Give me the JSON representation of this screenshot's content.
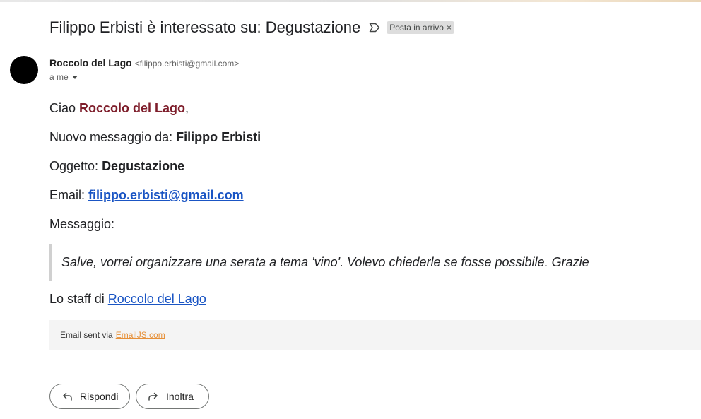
{
  "email": {
    "subject": "Filippo Erbisti è interessato su: Degustazione",
    "label_chip": "Posta in arrivo",
    "label_chip_close": "×",
    "sender_name": "Roccolo del Lago",
    "sender_email": "<filippo.erbisti@gmail.com>",
    "recipient": "a me"
  },
  "body": {
    "greeting_prefix": "Ciao ",
    "greeting_name": "Roccolo del Lago",
    "greeting_suffix": ",",
    "from_label": "Nuovo messaggio da: ",
    "from_name": "Filippo Erbisti",
    "subject_label": "Oggetto: ",
    "subject_value": "Degustazione",
    "email_label": "Email: ",
    "email_value": "filippo.erbisti@gmail.com",
    "message_label": "Messaggio:",
    "message_text": "Salve, vorrei organizzare una serata a tema 'vino'. Volevo chiederle se fosse possibile. Grazie",
    "signoff_prefix": "Lo staff di ",
    "signoff_link": "Roccolo del Lago"
  },
  "footer": {
    "sent_via": "Email sent via",
    "service_link": "EmailJS.com"
  },
  "actions": {
    "reply_label": "Rispondi",
    "forward_label": "Inoltra"
  },
  "colors": {
    "brand": "#7e1e2b",
    "link": "#1a55c4",
    "footer_link": "#e69038"
  },
  "icons": {
    "label": "label-outline-icon",
    "reply": "reply-arrow-icon",
    "forward": "forward-arrow-icon",
    "caret": "chevron-down-icon"
  }
}
